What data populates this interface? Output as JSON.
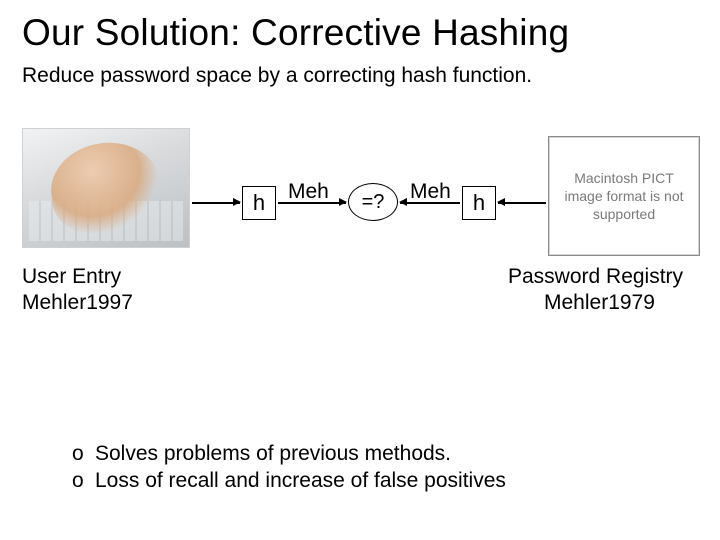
{
  "title": "Our Solution: Corrective Hashing",
  "subtitle": "Reduce password space by a correcting hash function.",
  "diagram": {
    "h_left": "h",
    "h_right": "h",
    "eq": "=?",
    "meh1": "Meh",
    "meh2": "Meh",
    "pict_placeholder": "Macintosh PICT image format is not supported"
  },
  "user_entry": {
    "line1": "User Entry",
    "line2": "Mehler1997"
  },
  "registry": {
    "line1": "Password Registry",
    "line2": "Mehler1979"
  },
  "bullets": {
    "marker": "o",
    "b1": "Solves problems of previous methods.",
    "b2": "Loss of recall and increase of false positives"
  }
}
